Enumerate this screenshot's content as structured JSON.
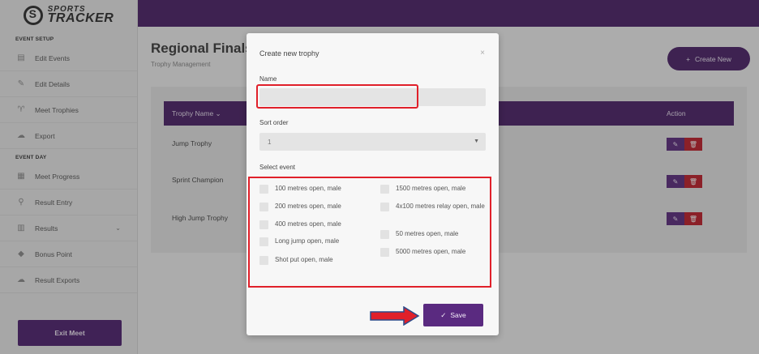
{
  "brand": {
    "line1": "SPORTS",
    "line2": "TRACKER"
  },
  "sidebar": {
    "sections": [
      {
        "label": "EVENT SETUP",
        "items": [
          {
            "label": "Edit Events",
            "icon": "calendar-icon"
          },
          {
            "label": "Edit Details",
            "icon": "edit-icon"
          },
          {
            "label": "Meet Trophies",
            "icon": "trophy-icon"
          },
          {
            "label": "Export",
            "icon": "cloud-icon"
          }
        ]
      },
      {
        "label": "EVENT DAY",
        "items": [
          {
            "label": "Meet Progress",
            "icon": "grid-icon"
          },
          {
            "label": "Result Entry",
            "icon": "search-icon"
          },
          {
            "label": "Results",
            "icon": "bar-chart-icon",
            "chevron": "⌄"
          },
          {
            "label": "Bonus Point",
            "icon": "medal-icon"
          },
          {
            "label": "Result Exports",
            "icon": "cloud-icon"
          }
        ]
      }
    ],
    "exit_label": "Exit Meet"
  },
  "page": {
    "title": "Regional Finals",
    "subtitle": "Trophy Management",
    "create_label": "Create New",
    "create_icon": "+"
  },
  "table": {
    "col_name": "Trophy Name ⌄",
    "col_action": "Action",
    "rows": [
      {
        "name": "Jump Trophy"
      },
      {
        "name": "Sprint Champion"
      },
      {
        "name": "High Jump Trophy"
      }
    ]
  },
  "modal": {
    "title": "Create new trophy",
    "close": "×",
    "name_label": "Name",
    "name_value": "",
    "sort_label": "Sort order",
    "sort_value": "1",
    "event_label": "Select event",
    "events_left": [
      "100 metres open, male",
      "200 metres open, male",
      "400 metres open, male",
      "Long jump open, male",
      "Shot put open, male"
    ],
    "events_right": [
      "1500 metres open, male",
      "4x100 metres relay open, male",
      "50 metres open, male",
      "5000 metres open, male"
    ],
    "save_label": "Save",
    "save_icon": "✓"
  },
  "colors": {
    "primary": "#4a2068",
    "danger": "#c01c28",
    "annotation": "#e0202a"
  }
}
